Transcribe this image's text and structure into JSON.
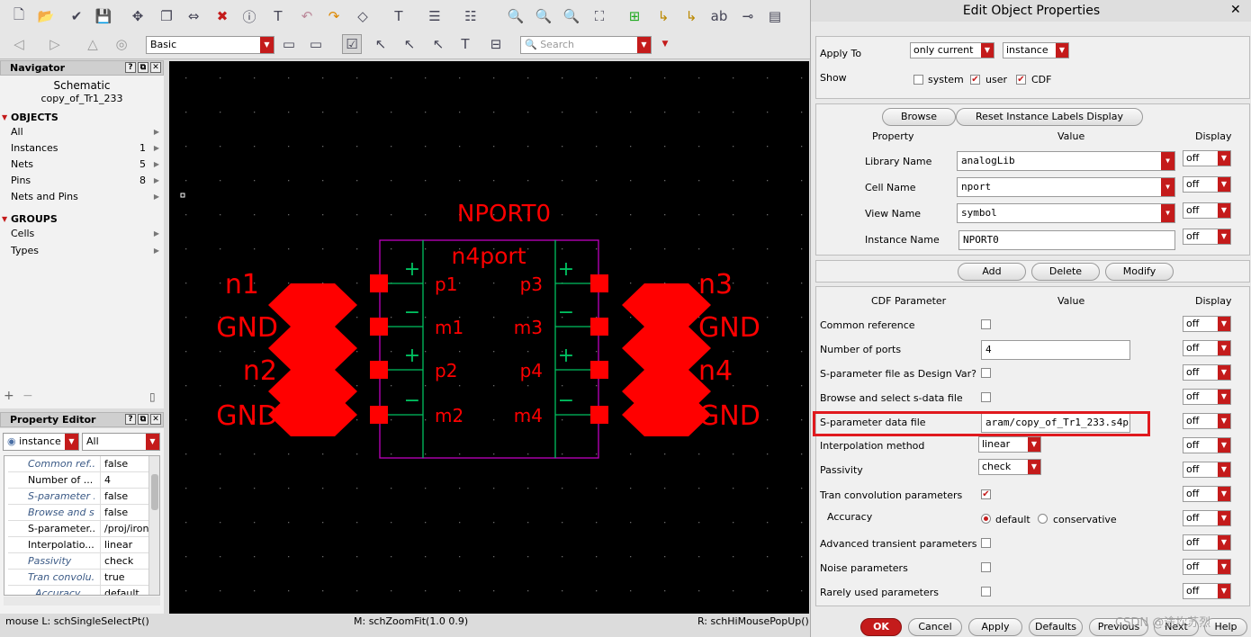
{
  "toolbar": {
    "mode_select": "Basic",
    "search_placeholder": "Search"
  },
  "navigator": {
    "title": "Navigator",
    "view": "Schematic",
    "cell": "copy_of_Tr1_233",
    "objects_header": "OBJECTS",
    "objects": [
      {
        "label": "All",
        "count": ""
      },
      {
        "label": "Instances",
        "count": "1"
      },
      {
        "label": "Nets",
        "count": "5"
      },
      {
        "label": "Pins",
        "count": "8"
      },
      {
        "label": "Nets and Pins",
        "count": ""
      }
    ],
    "groups_header": "GROUPS",
    "groups": [
      {
        "label": "Cells"
      },
      {
        "label": "Types"
      }
    ]
  },
  "property_editor": {
    "title": "Property Editor",
    "filter": "instance (",
    "scope": "All",
    "rows": [
      {
        "key": "Common ref...",
        "value": "false"
      },
      {
        "key": "Number of ...",
        "value": "4"
      },
      {
        "key": "S-parameter ...",
        "value": "false"
      },
      {
        "key": "Browse and s...",
        "value": "false"
      },
      {
        "key": "S-parameter...",
        "value": "/proj/iron/"
      },
      {
        "key": "Interpolatio...",
        "value": "linear"
      },
      {
        "key": "Passivity",
        "value": "check"
      },
      {
        "key": "Tran convolu...",
        "value": "true"
      },
      {
        "key": "Accuracy",
        "value": "default"
      }
    ]
  },
  "schematic": {
    "instance_label": "NPORT0",
    "cell_label": "n4port",
    "left_nets": [
      "n1",
      "GND",
      "n2",
      "GND"
    ],
    "right_nets": [
      "n3",
      "GND",
      "n4",
      "GND"
    ],
    "left_pins": [
      "p1",
      "m1",
      "p2",
      "m2"
    ],
    "right_pins": [
      "p3",
      "m3",
      "p4",
      "m4"
    ],
    "signs": [
      "+",
      "−",
      "+",
      "−"
    ]
  },
  "status": {
    "left": "mouse L: schSingleSelectPt()",
    "middle": "M: schZoomFit(1.0 0.9)",
    "right": "R: schHiMousePopUp()"
  },
  "dialog": {
    "title": "Edit Object Properties",
    "apply_to_label": "Apply To",
    "apply_to_scope": "only current",
    "apply_to_type": "instance",
    "show_label": "Show",
    "show_system": "system",
    "show_user": "user",
    "show_cdf": "CDF",
    "browse": "Browse",
    "reset_labels": "Reset Instance Labels Display",
    "col_property": "Property",
    "col_value": "Value",
    "col_display": "Display",
    "properties": [
      {
        "name": "Library Name",
        "value": "analogLib",
        "display": "off"
      },
      {
        "name": "Cell Name",
        "value": "nport",
        "display": "off"
      },
      {
        "name": "View Name",
        "value": "symbol",
        "display": "off"
      },
      {
        "name": "Instance Name",
        "value": "NPORT0",
        "display": "off"
      }
    ],
    "add": "Add",
    "delete": "Delete",
    "modify": "Modify",
    "col_cdf": "CDF Parameter",
    "cdf": [
      {
        "name": "Common reference",
        "display": "off"
      },
      {
        "name": "Number of ports",
        "value": "4",
        "display": "off"
      },
      {
        "name": "S-parameter file as Design Var?",
        "display": "off"
      },
      {
        "name": "Browse and select s-data file",
        "display": "off"
      },
      {
        "name": "S-parameter data file",
        "value": "aram/copy_of_Tr1_233.s4p",
        "display": "off"
      },
      {
        "name": "Interpolation method",
        "value": "linear",
        "display": "off"
      },
      {
        "name": "Passivity",
        "value": "check",
        "display": "off"
      },
      {
        "name": "Tran convolution parameters",
        "display": "off"
      },
      {
        "name": "Accuracy",
        "opt1": "default",
        "opt2": "conservative",
        "display": "off"
      },
      {
        "name": "Advanced transient parameters",
        "display": "off"
      },
      {
        "name": "Noise parameters",
        "display": "off"
      },
      {
        "name": "Rarely used parameters",
        "display": "off"
      }
    ],
    "buttons": [
      "OK",
      "Cancel",
      "Apply",
      "Defaults",
      "Previous",
      "Next",
      "Help"
    ],
    "watermark": "CSDN @途坎苏烈"
  },
  "colors": {
    "accent_red": "#c41b1b",
    "highlight": "#e0191e",
    "schematic_red": "#ff0000",
    "symbol_border": "#c000c0",
    "symbol_lines": "#00c060"
  }
}
